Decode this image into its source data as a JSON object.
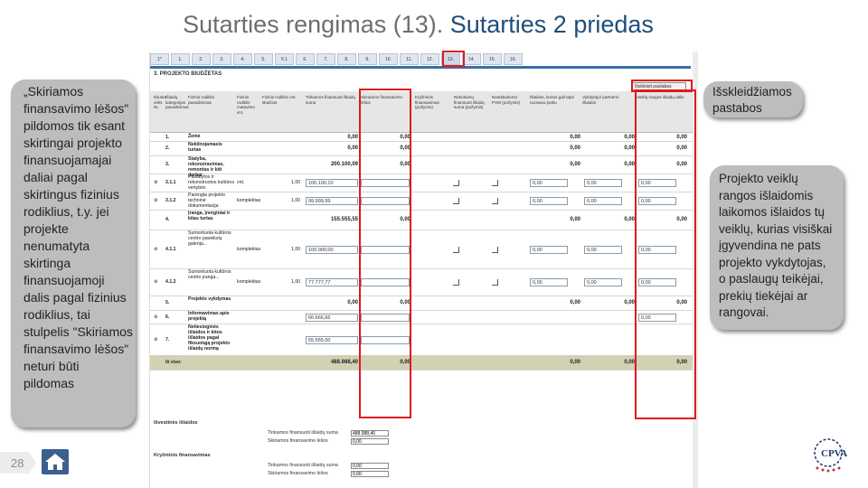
{
  "slide": {
    "title_part1": "Sutarties rengimas (13).",
    "title_part2": "Sutarties 2 priedas",
    "page_number": "28",
    "colors": {
      "title_gray": "#6e6e6e",
      "title_blue": "#1f4e79",
      "highlight": "#e0191f",
      "callout_bg": "#bdbdbd"
    }
  },
  "callouts": {
    "left": [
      "„Skiriamos",
      "finansavimo lėšos\"",
      "pildomos tik esant",
      "skirtingai projekto",
      "finansuojamajai",
      "daliai pagal",
      "skirtingus fizinius",
      "rodiklius, t.y. jei",
      "projekte",
      "nenumatyta",
      "skirtinga",
      "finansuojamoji",
      "dalis pagal fizinius",
      "rodiklius, tai",
      "stulpelis \"Skiriamos",
      "finansavimo lėšos\"",
      "neturi būti",
      "pildomas"
    ],
    "right_top": [
      "Išskleidžiamos",
      "pastabos"
    ],
    "right_bottom": [
      "Projekto veiklų",
      "rangos išlaidomis",
      "laikomos išlaidos tų",
      "veiklų, kurias visiškai",
      "įgyvendina ne pats",
      "projekto vykdytojas,",
      "o paslaugų teikėjai,",
      "prekių tiekėjai ar",
      "rangovai."
    ]
  },
  "screenshot": {
    "tabs": [
      "1*",
      "1.",
      "2.",
      "3.",
      "4.",
      "5.",
      "5.1",
      "6.",
      "7.",
      "8.",
      "9.",
      "10.",
      "11.",
      "12.",
      "13.",
      "14.",
      "15.",
      "16."
    ],
    "active_tab": "13.",
    "heading": "3. PROJEKTO BIUDŽETAS",
    "notes_button": "Išskleisti pastabas",
    "headers": [
      "Eilutės eilės Nr.",
      "Išlaidų kategorijos pavadinimas",
      "Fizinio rodiklio pavadinimas",
      "Fizinio rodiklio matavimo vnt.",
      "Fizinio rodiklio vnt. skaičius",
      "Tinkamos finansuoti išlaidų suma",
      "Skiriamos finansavimo lėšos",
      "Kryžminis finansavimas (požymis)",
      "Netinkamų finansuoti išlaidų suma (požymis)",
      "Neatskaitomo PVM (požymis)",
      "Išlaidos, kurios gali tapti nuosavu įnašu",
      "Vykdytojo/ partnerio išlaidos",
      "Veiklų rangos išlaidų dalis"
    ],
    "rows": [
      {
        "no": "1.",
        "name": "Žemė",
        "unit": "",
        "qty": "",
        "eligible": "0,00",
        "allocated": "0,00",
        "own": "0,00",
        "partner": "0,00",
        "contract": "0,00"
      },
      {
        "no": "2.",
        "name": "Nekilnojamasis turtas",
        "unit": "",
        "qty": "",
        "eligible": "0,00",
        "allocated": "0,00",
        "own": "0,00",
        "partner": "0,00",
        "contract": "0,00"
      },
      {
        "no": "3.",
        "name": "Statyba, rekonstravimas, remontas ir kiti darbai",
        "unit": "",
        "qty": "",
        "eligible": "200.100,09",
        "allocated": "0,00",
        "own": "0,00",
        "partner": "0,00",
        "contract": "0,00"
      },
      {
        "no": "3.1.1",
        "name": "Pastatytos ir rekonstruotos kultūros vertybės",
        "unit": "vnt.",
        "qty": "1,00",
        "eligible": "100.100,10",
        "allocated": "",
        "own": "0,00",
        "partner": "0,00",
        "contract": "0,00"
      },
      {
        "no": "3.1.2",
        "name": "Parengta projekto techninė dokumentacija",
        "unit": "komplektas",
        "qty": "1,00",
        "eligible": "99.999,99",
        "allocated": "",
        "own": "0,00",
        "partner": "0,00",
        "contract": "0,00"
      },
      {
        "no": "4.",
        "name": "Įranga, įrenginiai ir kitas turtas",
        "unit": "",
        "qty": "",
        "eligible": "155.555,55",
        "allocated": "0,00",
        "own": "0,00",
        "partner": "0,00",
        "contract": "0,00"
      },
      {
        "no": "4.1.1",
        "name": "Sumontuota kultūros centro paveikslų galerija...",
        "unit": "komplektas",
        "qty": "1,00",
        "eligible": "100.000,00",
        "allocated": "",
        "own": "0,00",
        "partner": "0,00",
        "contract": "0,00"
      },
      {
        "no": "4.1.2",
        "name": "Sumontuota kultūros centro įranga...",
        "unit": "komplektas",
        "qty": "1,00",
        "eligible": "77.777,77",
        "allocated": "",
        "own": "0,00",
        "partner": "0,00",
        "contract": "0,00"
      },
      {
        "no": "5.",
        "name": "Projekto vykdymas",
        "unit": "",
        "qty": "",
        "eligible": "0,00",
        "allocated": "0,00",
        "own": "0,00",
        "partner": "0,00",
        "contract": "0,00"
      },
      {
        "no": "6.",
        "name": "Informavimas apie projektą",
        "unit": "",
        "qty": "",
        "eligible": "66.666,66",
        "allocated": "",
        "own": "",
        "partner": "",
        "contract": "0,00"
      },
      {
        "no": "7.",
        "name": "Netiesioginės išlaidos ir kitos išlaidos pagal fiksuotąją projekto išlaidų normą",
        "unit": "",
        "qty": "",
        "eligible": "55.555,00",
        "allocated": "",
        "own": "",
        "partner": "",
        "contract": ""
      },
      {
        "no": "Iš viso:",
        "name": "",
        "unit": "",
        "qty": "",
        "eligible": "488.988,40",
        "allocated": "0,00",
        "own": "0,00",
        "partner": "0,00",
        "contract": "0,00"
      }
    ],
    "summary1_title": "Išvestinės išlaidos",
    "summary1": [
      {
        "label": "Tinkamos finansuoti išlaidų suma",
        "value": "488.988,40"
      },
      {
        "label": "Skiriamos finansavimo lėšos",
        "value": "0,00"
      }
    ],
    "summary2_title": "Kryžminis finansavimas",
    "summary2": [
      {
        "label": "Tinkamos finansuoti išlaidų suma",
        "value": "0,00"
      },
      {
        "label": "Skiriamos finansavimo lėšos",
        "value": "0,00"
      }
    ],
    "logo_text": "CPVA"
  }
}
